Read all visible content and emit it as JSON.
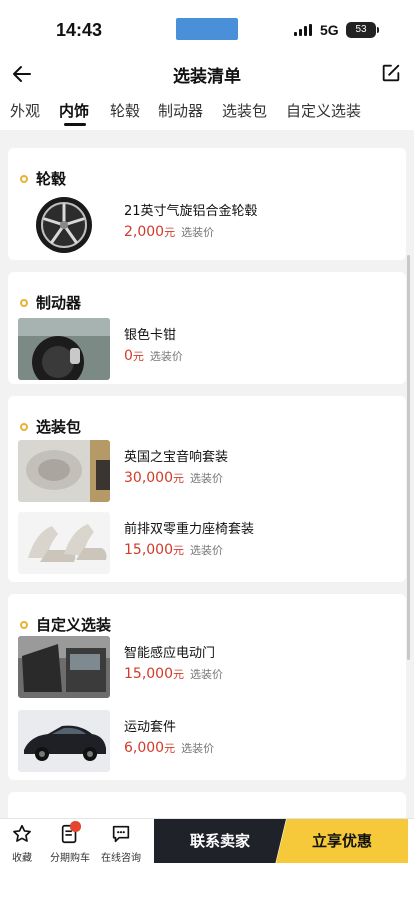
{
  "status_bar": {
    "time": "14:43",
    "network": "5G",
    "battery": "53"
  },
  "header": {
    "title": "选装清单"
  },
  "tabs": [
    {
      "label": "外观"
    },
    {
      "label": "内饰"
    },
    {
      "label": "轮毂"
    },
    {
      "label": "制动器"
    },
    {
      "label": "选装包"
    },
    {
      "label": "自定义选装"
    }
  ],
  "active_tab": "内饰",
  "sections": {
    "wheels": {
      "title": "轮毂",
      "items": [
        {
          "name": "21英寸气旋铝合金轮毂",
          "price": "2,000",
          "unit": "元",
          "tag": "选装价"
        }
      ]
    },
    "brakes": {
      "title": "制动器",
      "items": [
        {
          "name": "银色卡钳",
          "price": "0",
          "unit": "元",
          "tag": "选装价"
        }
      ]
    },
    "packages": {
      "title": "选装包",
      "items": [
        {
          "name": "英国之宝音响套装",
          "price": "30,000",
          "unit": "元",
          "tag": "选装价"
        },
        {
          "name": "前排双零重力座椅套装",
          "price": "15,000",
          "unit": "元",
          "tag": "选装价"
        }
      ]
    },
    "custom": {
      "title": "自定义选装",
      "items": [
        {
          "name": "智能感应电动门",
          "price": "15,000",
          "unit": "元",
          "tag": "选装价"
        },
        {
          "name": "运动套件",
          "price": "6,000",
          "unit": "元",
          "tag": "选装价"
        }
      ]
    }
  },
  "bottom_bar": {
    "favorite": "收藏",
    "installment": "分期购车",
    "consult": "在线咨询",
    "contact": "联系卖家",
    "offer": "立享优惠"
  },
  "colors": {
    "accent": "#f5c93a",
    "price": "#d23a2a",
    "dark_button": "#1f2329"
  }
}
